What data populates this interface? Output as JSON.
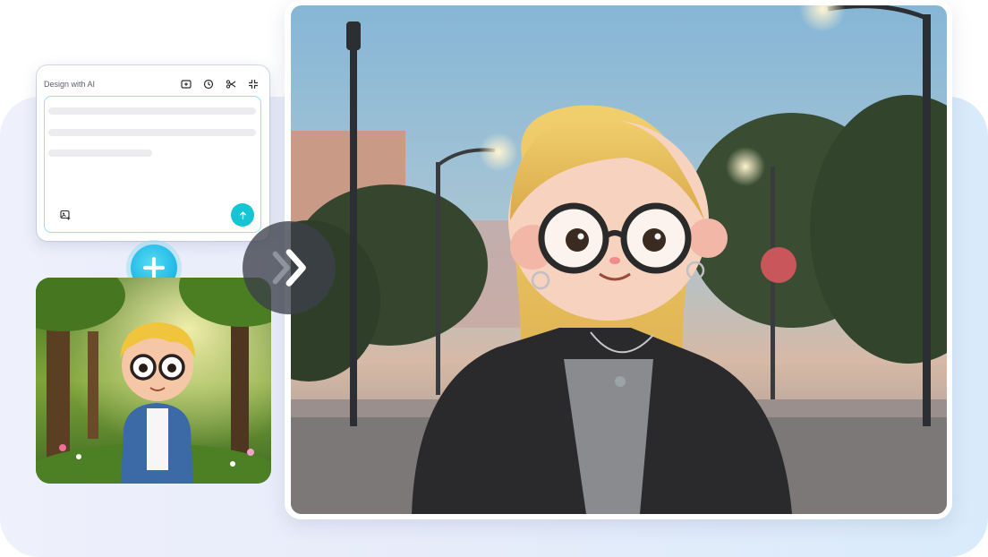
{
  "ai_panel": {
    "title": "Design with AI",
    "tools": [
      "add-frame-icon",
      "history-icon",
      "scissors-icon",
      "collapse-icon"
    ],
    "attach_icon": "image-attach-icon",
    "send_icon": "arrow-up-icon"
  },
  "colors": {
    "accent": "#17c4d4",
    "input_border": "#8fe3ea",
    "backdrop": "#e7ecfa"
  },
  "decor": {
    "plus_icon": "plus-icon",
    "arrow_icon": "double-chevron-right-icon"
  }
}
